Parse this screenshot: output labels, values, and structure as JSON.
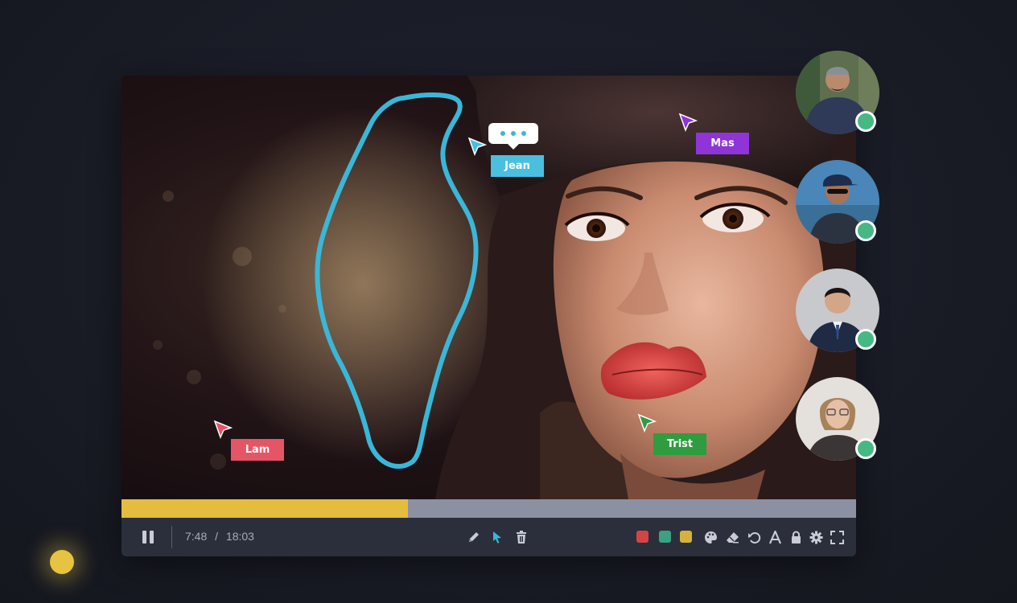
{
  "player": {
    "time": {
      "current": "7:48",
      "separator": "/",
      "total": "18:03"
    },
    "progress": 0.39,
    "colors": {
      "progress_fill": "#e4bd3f",
      "progress_track": "#8b91a3",
      "stroke": "#3ab7d8"
    }
  },
  "cursors": [
    {
      "name": "Jean",
      "color": "#4bbfe0"
    },
    {
      "name": "Mas",
      "color": "#8f34d6"
    },
    {
      "name": "Lam",
      "color": "#e45565"
    },
    {
      "name": "Trist",
      "color": "#2f9c3f"
    }
  ],
  "toolbar": {
    "left_icons": [
      "pause-icon"
    ],
    "center_icons": [
      "pencil-icon",
      "pointer-icon",
      "trash-icon"
    ],
    "swatches": [
      "#d54444",
      "#3aa183",
      "#d6b23c"
    ],
    "right_icons": [
      "palette-icon",
      "eraser-icon",
      "undo-icon",
      "text-icon",
      "lock-icon",
      "gear-icon",
      "fullscreen-icon"
    ]
  },
  "participants": [
    {
      "status_color": "#45b884",
      "status": "online"
    },
    {
      "status_color": "#45b884",
      "status": "online"
    },
    {
      "status_color": "#45b884",
      "status": "online"
    },
    {
      "status_color": "#45b884",
      "status": "online"
    }
  ]
}
